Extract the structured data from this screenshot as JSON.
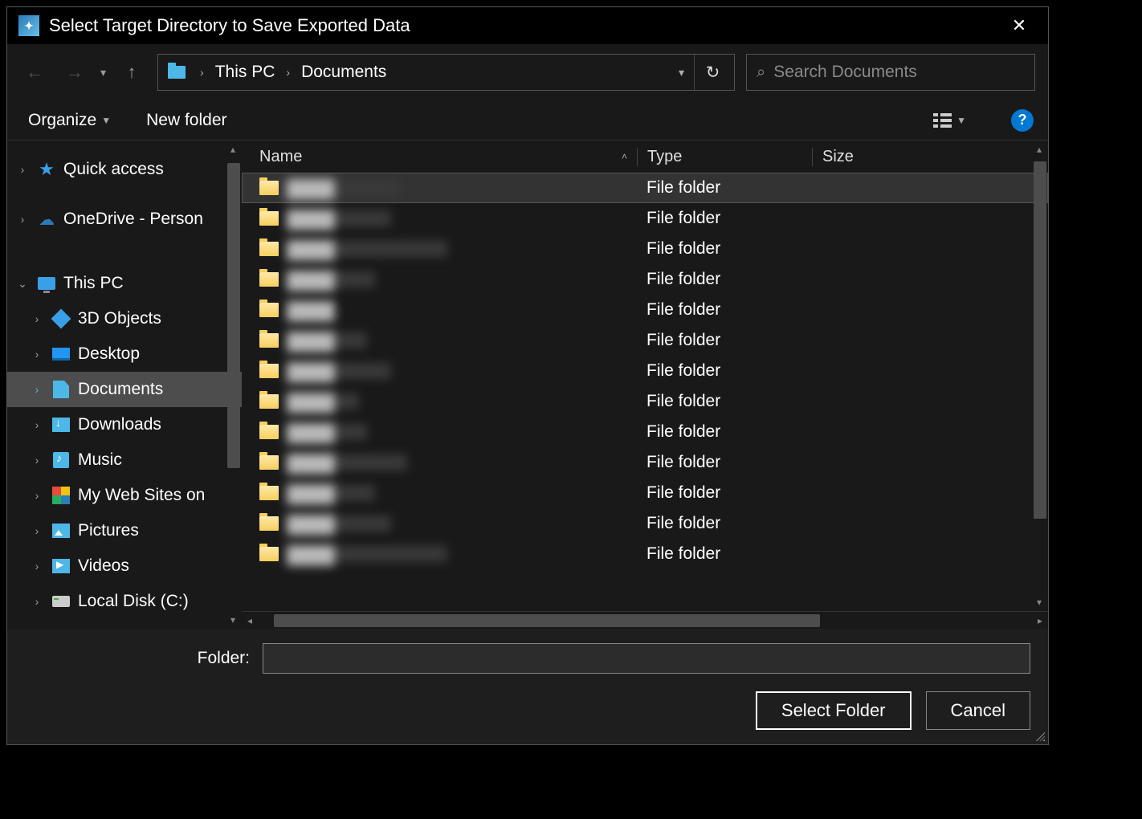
{
  "window": {
    "title": "Select Target Directory to Save Exported Data"
  },
  "breadcrumb": {
    "parts": [
      "This PC",
      "Documents"
    ]
  },
  "search": {
    "placeholder": "Search Documents"
  },
  "toolbar": {
    "organize": "Organize",
    "newfolder": "New folder"
  },
  "tree": {
    "items": [
      {
        "label": "Quick access",
        "icon": "quick-access",
        "expanded": false,
        "depth": 0
      },
      {
        "label": "OneDrive - Person",
        "icon": "onedrive",
        "expanded": false,
        "depth": 0
      },
      {
        "label": "This PC",
        "icon": "this-pc",
        "expanded": true,
        "depth": 0
      },
      {
        "label": "3D Objects",
        "icon": "3d-objects",
        "expanded": false,
        "depth": 1
      },
      {
        "label": "Desktop",
        "icon": "desktop",
        "expanded": false,
        "depth": 1
      },
      {
        "label": "Documents",
        "icon": "documents",
        "expanded": false,
        "depth": 1,
        "selected": true
      },
      {
        "label": "Downloads",
        "icon": "downloads",
        "expanded": false,
        "depth": 1
      },
      {
        "label": "Music",
        "icon": "music",
        "expanded": false,
        "depth": 1
      },
      {
        "label": "My Web Sites on",
        "icon": "mywebsites",
        "expanded": false,
        "depth": 1
      },
      {
        "label": "Pictures",
        "icon": "pictures",
        "expanded": false,
        "depth": 1
      },
      {
        "label": "Videos",
        "icon": "videos",
        "expanded": false,
        "depth": 1
      },
      {
        "label": "Local Disk (C:)",
        "icon": "local-disk",
        "expanded": false,
        "depth": 1
      }
    ]
  },
  "columns": {
    "name": "Name",
    "type": "Type",
    "size": "Size"
  },
  "files": [
    {
      "name_hidden": true,
      "name_width": 140,
      "type": "File folder",
      "selected": true
    },
    {
      "name_hidden": true,
      "name_width": 130,
      "type": "File folder"
    },
    {
      "name_hidden": true,
      "name_width": 200,
      "type": "File folder"
    },
    {
      "name_hidden": true,
      "name_width": 110,
      "type": "File folder"
    },
    {
      "name_hidden": true,
      "name_width": 60,
      "type": "File folder"
    },
    {
      "name_hidden": true,
      "name_width": 100,
      "type": "File folder"
    },
    {
      "name_hidden": true,
      "name_width": 130,
      "type": "File folder"
    },
    {
      "name_hidden": true,
      "name_width": 90,
      "type": "File folder"
    },
    {
      "name_hidden": true,
      "name_width": 100,
      "type": "File folder"
    },
    {
      "name_hidden": true,
      "name_width": 150,
      "type": "File folder"
    },
    {
      "name_hidden": true,
      "name_width": 110,
      "type": "File folder"
    },
    {
      "name_hidden": true,
      "name_width": 130,
      "type": "File folder"
    },
    {
      "name_hidden": true,
      "name_width": 200,
      "type": "File folder"
    }
  ],
  "footer": {
    "folder_label": "Folder:",
    "folder_value": "",
    "select": "Select Folder",
    "cancel": "Cancel"
  }
}
